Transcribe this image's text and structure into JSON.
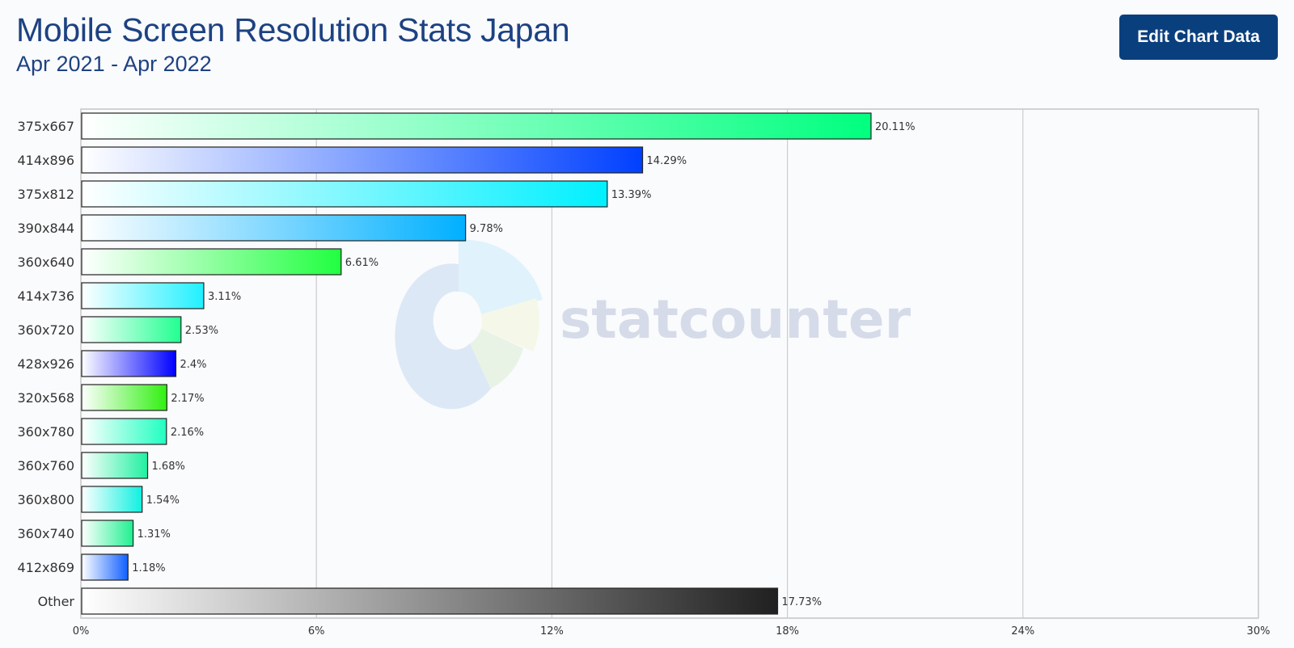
{
  "header": {
    "title": "Mobile Screen Resolution Stats Japan",
    "subtitle": "Apr 2021 - Apr 2022",
    "edit_button_label": "Edit Chart Data"
  },
  "watermark": {
    "text": "statcounter"
  },
  "chart_data": {
    "type": "bar",
    "orientation": "horizontal",
    "title": "Mobile Screen Resolution Stats Japan",
    "subtitle": "Apr 2021 - Apr 2022",
    "xlabel": "",
    "ylabel": "",
    "xlim": [
      0,
      30
    ],
    "x_ticks": [
      0,
      6,
      12,
      18,
      24,
      30
    ],
    "x_tick_labels": [
      "0%",
      "6%",
      "12%",
      "18%",
      "24%",
      "30%"
    ],
    "grid": "vertical",
    "legend": "none",
    "categories": [
      "375x667",
      "414x896",
      "375x812",
      "390x844",
      "360x640",
      "414x736",
      "360x720",
      "428x926",
      "320x568",
      "360x780",
      "360x760",
      "360x800",
      "360x740",
      "412x869",
      "Other"
    ],
    "values": [
      20.11,
      14.29,
      13.39,
      9.78,
      6.61,
      3.11,
      2.53,
      2.4,
      2.17,
      2.16,
      1.68,
      1.54,
      1.31,
      1.18,
      17.73
    ],
    "value_labels": [
      "20.11%",
      "14.29%",
      "13.39%",
      "9.78%",
      "6.61%",
      "3.11%",
      "2.53%",
      "2.4%",
      "2.17%",
      "2.16%",
      "1.68%",
      "1.54%",
      "1.31%",
      "1.18%",
      "17.73%"
    ],
    "bar_colors": [
      "#00ff7f",
      "#0040ff",
      "#00f0ff",
      "#00b0ff",
      "#20ff40",
      "#20f0ff",
      "#20ff90",
      "#0000ff",
      "#30f010",
      "#20ffc0",
      "#20f0a0",
      "#10f0e0",
      "#20f090",
      "#1060ff",
      "#202020"
    ]
  }
}
